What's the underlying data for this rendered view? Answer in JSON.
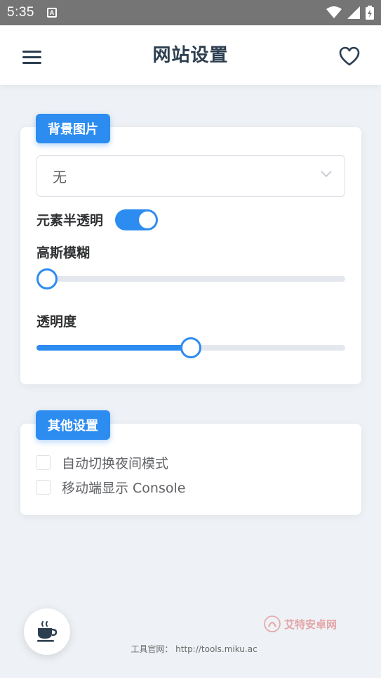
{
  "status_bar": {
    "time": "5:35",
    "notif_glyph": "A"
  },
  "header": {
    "title": "网站设置"
  },
  "background_card": {
    "tag": "背景图片",
    "select_value": "无",
    "semi_transparent_label": "元素半透明",
    "semi_transparent_on": true,
    "blur_label": "高斯模糊",
    "blur_value": 0,
    "opacity_label": "透明度",
    "opacity_value": 50
  },
  "other_card": {
    "tag": "其他设置",
    "options": [
      {
        "label": "自动切换夜间模式",
        "checked": false
      },
      {
        "label": "移动端显示 Console",
        "checked": false
      }
    ]
  },
  "footer": {
    "text": "工具官网： http://tools.miku.ac"
  },
  "watermark": {
    "text": "艾特安卓网"
  },
  "colors": {
    "accent": "#2d8cf0",
    "title": "#2c3e50"
  },
  "icons": [
    "menu-icon",
    "heart-icon",
    "chevron-down-icon",
    "coffee-icon",
    "wifi-icon",
    "signal-icon",
    "battery-icon"
  ]
}
